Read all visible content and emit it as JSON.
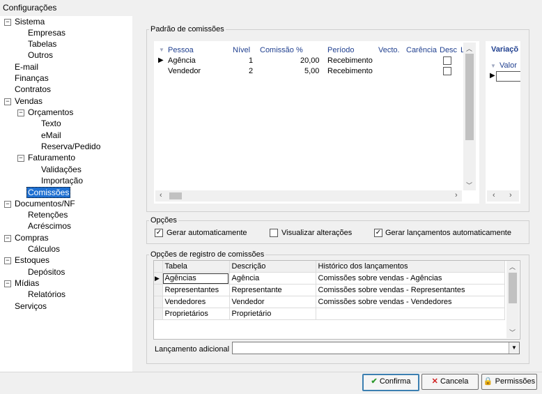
{
  "window": {
    "title": "Configurações"
  },
  "tree": {
    "sistema": "Sistema",
    "empresas": "Empresas",
    "tabelas": "Tabelas",
    "outros": "Outros",
    "email": "E-mail",
    "financas": "Finanças",
    "contratos": "Contratos",
    "vendas": "Vendas",
    "orcamentos": "Orçamentos",
    "texto": "Texto",
    "email2": "eMail",
    "reserva": "Reserva/Pedido",
    "faturamento": "Faturamento",
    "validacoes": "Validações",
    "importacao": "Importação",
    "comissoes": "Comissões",
    "documentos": "Documentos/NF",
    "retencoes": "Retenções",
    "acrescimos": "Acréscimos",
    "compras": "Compras",
    "calculos": "Cálculos",
    "estoques": "Estoques",
    "depositos": "Depósitos",
    "midias": "Mídias",
    "relatorios": "Relatórios",
    "servicos": "Serviços",
    "collapse_glyph": "−"
  },
  "padrao": {
    "label": "Padrão de comissões",
    "columns": [
      "Pessoa",
      "Nível",
      "Comissão %",
      "Período",
      "Vecto.",
      "Carência",
      "Desc",
      "L"
    ],
    "rows": [
      {
        "pessoa": "Agência",
        "nivel": "1",
        "comissao": "20,00",
        "periodo": "Recebimento"
      },
      {
        "pessoa": "Vendedor",
        "nivel": "2",
        "comissao": "5,00",
        "periodo": "Recebimento"
      }
    ],
    "variacoes_title": "Variaçõ",
    "variacoes_col": "Valor"
  },
  "opcoes": {
    "label": "Opções",
    "gerar_auto": {
      "label": "Gerar automaticamente",
      "checked": true
    },
    "visualizar": {
      "label": "Visualizar alterações",
      "checked": false
    },
    "gerar_lanc": {
      "label": "Gerar lançamentos automaticamente",
      "checked": true
    }
  },
  "registro": {
    "label": "Opções de registro de comissões",
    "columns": [
      "Tabela",
      "Descrição",
      "Histórico dos lançamentos"
    ],
    "rows": [
      {
        "tabela": "Agências",
        "descricao": "Agência",
        "historico": "Comissões sobre vendas - Agências"
      },
      {
        "tabela": "Representantes",
        "descricao": "Representante",
        "historico": "Comissões sobre vendas - Representantes"
      },
      {
        "tabela": "Vendedores",
        "descricao": "Vendedor",
        "historico": "Comissões sobre vendas - Vendedores"
      },
      {
        "tabela": "Proprietários",
        "descricao": "Proprietário",
        "historico": ""
      }
    ],
    "lancamento_label": "Lançamento adicional",
    "lancamento_value": ""
  },
  "buttons": {
    "confirma": "Confirma",
    "cancela": "Cancela",
    "permissoes": "Permissões"
  },
  "colors": {
    "selection": "#1e70d2",
    "header_text": "#1f3f8f",
    "confirm_check": "#2e9a2e",
    "cancel_x": "#d02020"
  }
}
